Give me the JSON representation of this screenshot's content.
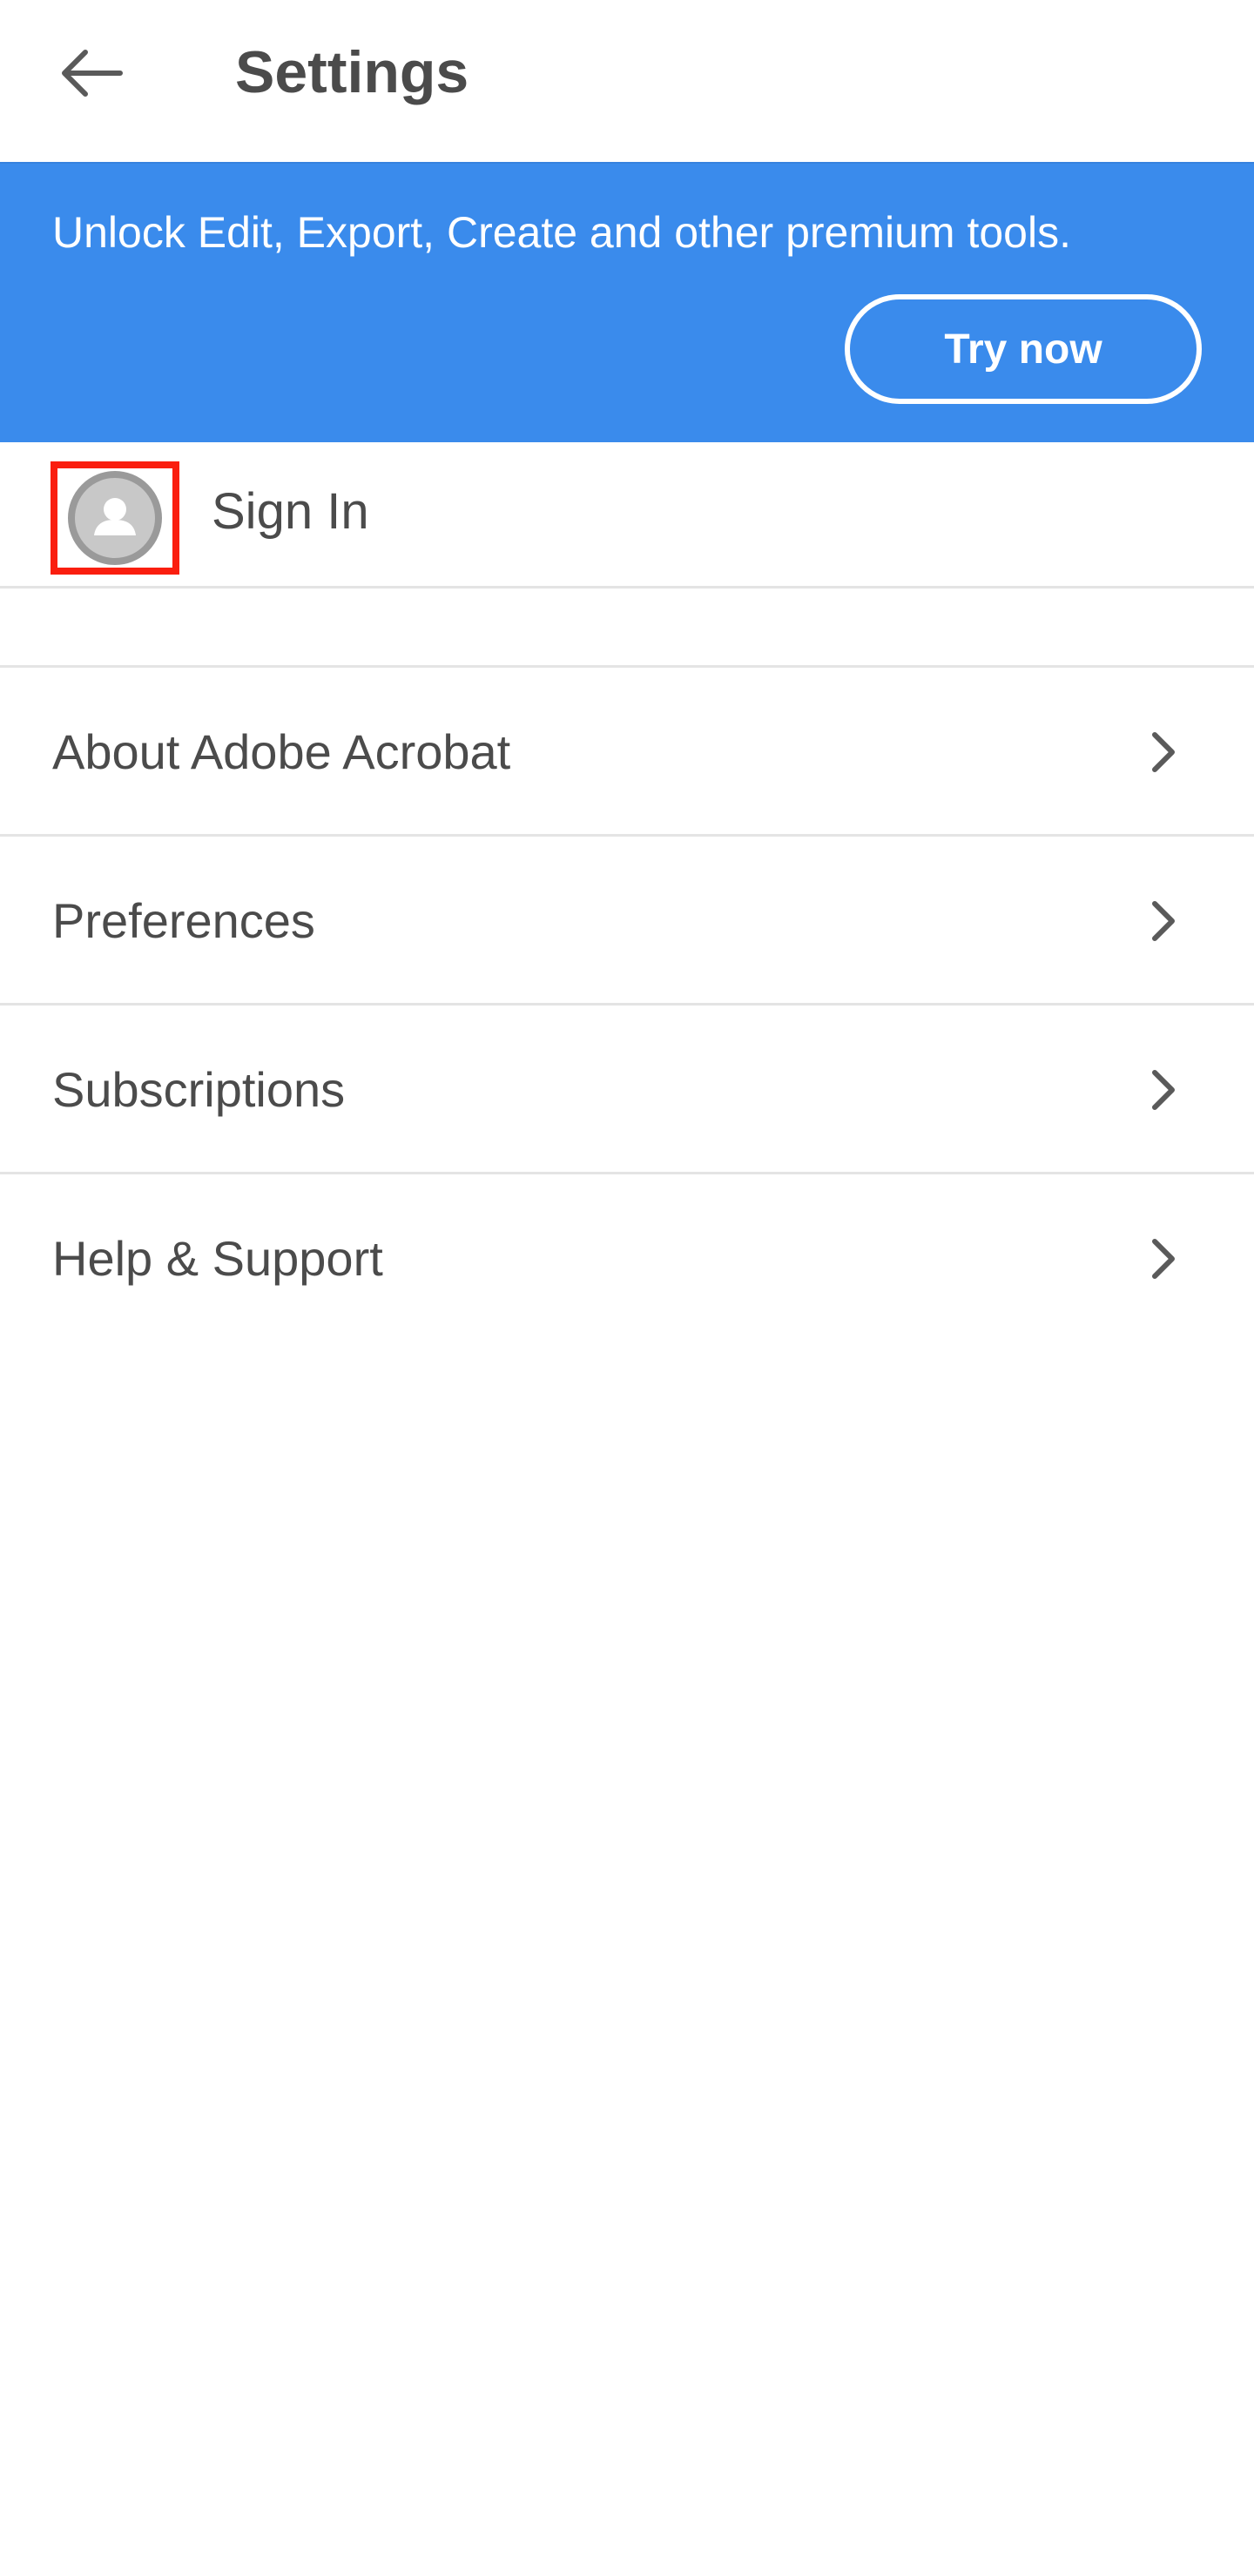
{
  "header": {
    "title": "Settings",
    "back_icon": "arrow-left-icon"
  },
  "banner": {
    "text": "Unlock Edit, Export, Create and other premium tools.",
    "cta_label": "Try now",
    "background_color": "#3a8bec"
  },
  "account": {
    "label": "Sign In",
    "avatar_icon": "user-avatar-icon",
    "highlight_color": "#fa1e0f"
  },
  "menu": {
    "items": [
      {
        "label": "About Adobe Acrobat",
        "icon": "chevron-right-icon"
      },
      {
        "label": "Preferences",
        "icon": "chevron-right-icon"
      },
      {
        "label": "Subscriptions",
        "icon": "chevron-right-icon"
      },
      {
        "label": "Help & Support",
        "icon": "chevron-right-icon"
      }
    ]
  }
}
